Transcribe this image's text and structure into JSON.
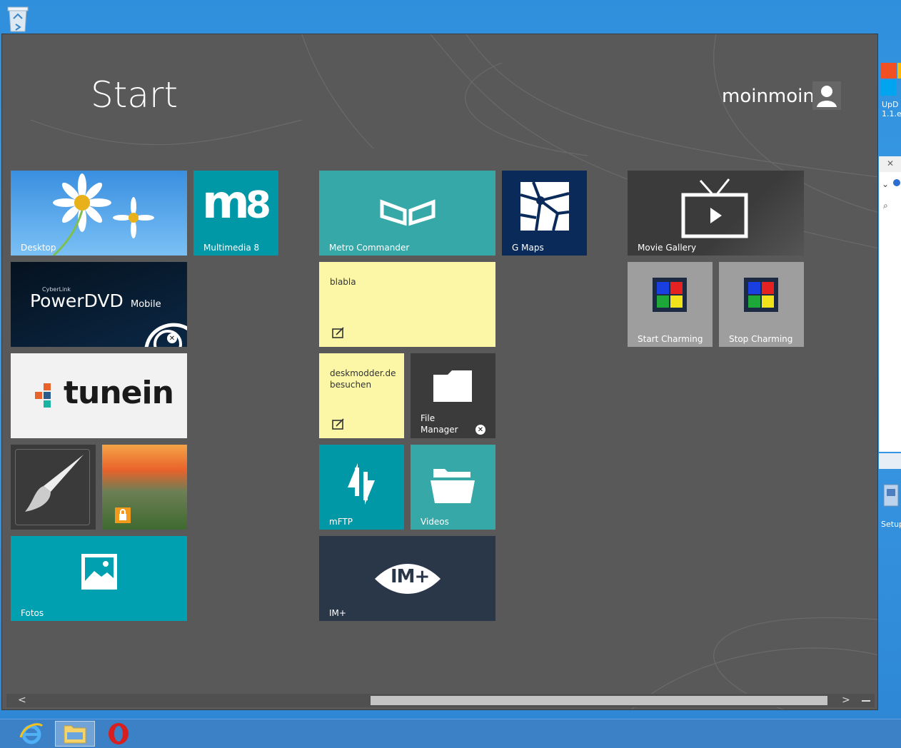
{
  "start": {
    "title": "Start",
    "user": "moinmoin"
  },
  "tiles": {
    "desktop": "Desktop",
    "multimedia": "Multimedia 8",
    "metro_commander": "Metro Commander",
    "gmaps": "G Maps",
    "movie_gallery": "Movie Gallery",
    "powerdvd_brand": "CyberLink",
    "powerdvd_name": "PowerDVD",
    "powerdvd_sub": "Mobile",
    "note_blabla": "blabla",
    "start_charming": "Start Charming",
    "stop_charming": "Stop Charming",
    "tunein": "tunein",
    "note_deskmodder": "deskmodder.de besuchen",
    "file_manager": "File Manager",
    "mftp": "mFTP",
    "videos": "Videos",
    "fotos": "Fotos",
    "im_plus": "IM+",
    "mini_logo": "IM+"
  },
  "desktop_right": {
    "upd_label": "UpD 1.1.e",
    "setup_label": "Setup"
  },
  "colors": {
    "teal": "#0097a7",
    "teal_light": "#36a8a8",
    "navy": "#0a2a5a",
    "note_yellow": "#fbf7a7",
    "dark_tile": "#3b3b3b",
    "gray_tile": "#9e9e9e",
    "im_dark": "#2a3748"
  }
}
